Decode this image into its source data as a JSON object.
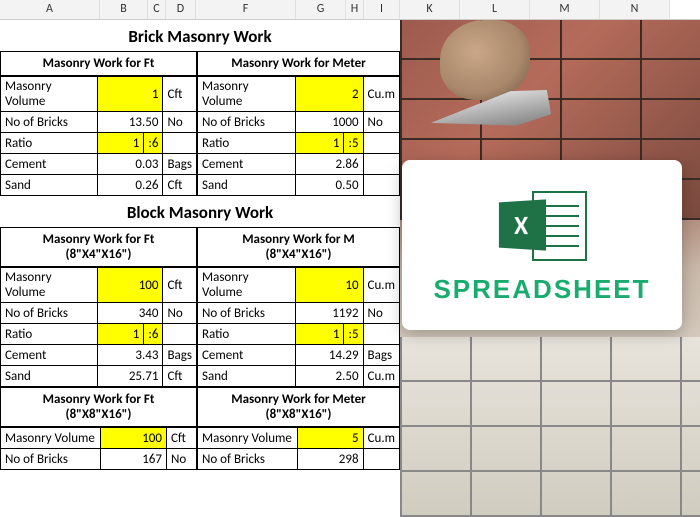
{
  "columns": [
    "A",
    "B",
    "C",
    "D",
    "F",
    "G",
    "H",
    "I",
    "K",
    "L",
    "M",
    "N"
  ],
  "brick": {
    "title": "Brick Masonry Work",
    "ft_header": "Masonry Work for Ft",
    "m_header": "Masonry Work for Meter",
    "rows_ft": [
      {
        "label": "Masonry Volume",
        "val": "1",
        "unit": "Cft",
        "hl": true
      },
      {
        "label": "No of Bricks",
        "val": "13.50",
        "unit": "No",
        "hl": false
      },
      {
        "label": "Ratio",
        "val": "1",
        "val2": ":6",
        "unit": "",
        "hl": true,
        "ratio": true
      },
      {
        "label": "Cement",
        "val": "0.03",
        "unit": "Bags",
        "hl": false
      },
      {
        "label": "Sand",
        "val": "0.26",
        "unit": "Cft",
        "hl": false
      }
    ],
    "rows_m": [
      {
        "label": "Masonry Volume",
        "val": "2",
        "unit": "Cu.m",
        "hl": true
      },
      {
        "label": "No of Bricks",
        "val": "1000",
        "unit": "No",
        "hl": false
      },
      {
        "label": "Ratio",
        "val": "1",
        "val2": ":5",
        "unit": "",
        "hl": true,
        "ratio": true
      },
      {
        "label": "Cement",
        "val": "2.86",
        "unit": "",
        "hl": false
      },
      {
        "label": "Sand",
        "val": "0.50",
        "unit": "",
        "hl": false
      }
    ]
  },
  "block": {
    "title": "Block Masonry Work",
    "ft_header": "Masonry Work for Ft",
    "ft_sub": "(8\"X4\"X16\")",
    "m_header": "Masonry Work for M",
    "m_sub": "(8\"X4\"X16\")",
    "rows_ft": [
      {
        "label": "Masonry Volume",
        "val": "100",
        "unit": "Cft",
        "hl": true
      },
      {
        "label": "No of Bricks",
        "val": "340",
        "unit": "No",
        "hl": false
      },
      {
        "label": "Ratio",
        "val": "1",
        "val2": ":6",
        "unit": "",
        "hl": true,
        "ratio": true
      },
      {
        "label": "Cement",
        "val": "3.43",
        "unit": "Bags",
        "hl": false
      },
      {
        "label": "Sand",
        "val": "25.71",
        "unit": "Cft",
        "hl": false
      }
    ],
    "rows_m": [
      {
        "label": "Masonry Volume",
        "val": "10",
        "unit": "Cu.m",
        "hl": true
      },
      {
        "label": "No of Bricks",
        "val": "1192",
        "unit": "No",
        "hl": false
      },
      {
        "label": "Ratio",
        "val": "1",
        "val2": ":5",
        "unit": "",
        "hl": true,
        "ratio": true
      },
      {
        "label": "Cement",
        "val": "14.29",
        "unit": "Bags",
        "hl": false
      },
      {
        "label": "Sand",
        "val": "2.50",
        "unit": "Cu.m",
        "hl": false
      }
    ],
    "ft_header2": "Masonry Work for Ft",
    "ft_sub2": "(8\"X8\"X16\")",
    "m_header2": "Masonry Work for Meter",
    "m_sub2": "(8\"X8\"X16\")",
    "rows_ft2": [
      {
        "label": "Masonry Volume",
        "val": "100",
        "unit": "Cft",
        "hl": true
      },
      {
        "label": "No of Bricks",
        "val": "167",
        "unit": "No",
        "hl": false
      }
    ],
    "rows_m2": [
      {
        "label": "Masonry Volume",
        "val": "5",
        "unit": "Cu.m",
        "hl": true
      },
      {
        "label": "No of Bricks",
        "val": "298",
        "unit": "",
        "hl": false
      }
    ]
  },
  "logo": {
    "badge": "X",
    "text": "SPREADSHEET"
  }
}
